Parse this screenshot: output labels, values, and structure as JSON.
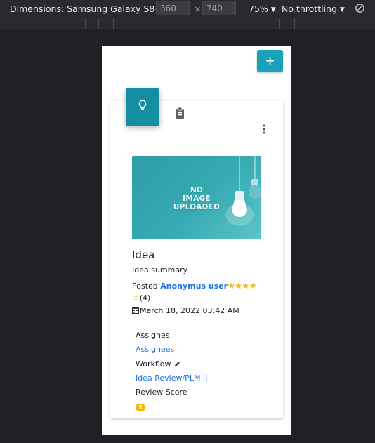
{
  "devtools": {
    "dimensions_label": "Dimensions: Samsung Galaxy S8+",
    "width_value": "360",
    "times_symbol": "×",
    "height_value": "740",
    "zoom_label": "75%",
    "throttling_label": "No throttling"
  },
  "app": {
    "add_label": "+",
    "idea_card": {
      "image_text": "NO\nIMAGE\nUPLOADED",
      "title": "Idea",
      "summary": "Idea summary",
      "posted_prefix": "Posted",
      "author": "Anonymus user",
      "filled_stars": "★★★★",
      "empty_star": "☆",
      "rating_count": "(4)",
      "rating_value": 4,
      "rating_max": 5,
      "date": "March 18, 2022 03:42 AM",
      "assignees_label": "Assignes",
      "assignees_link": "Assignees",
      "workflow_label": "Workflow",
      "workflow_link": "Idea Review/PLM II",
      "review_score_label": "Review Score",
      "review_score_value": "5"
    }
  },
  "colors": {
    "accent": "#17a2b8",
    "tab_active": "#148ea3",
    "link": "#1a73e8",
    "star": "#f5b800",
    "badge": "#f5b800"
  },
  "icons": {
    "idea_tab": "lightbulb-icon",
    "second_tab": "clipboard-icon",
    "menu": "kebab-menu-icon",
    "date": "calendar-icon",
    "edit": "pencil-icon",
    "device_toolbar": "rotate-icon"
  }
}
